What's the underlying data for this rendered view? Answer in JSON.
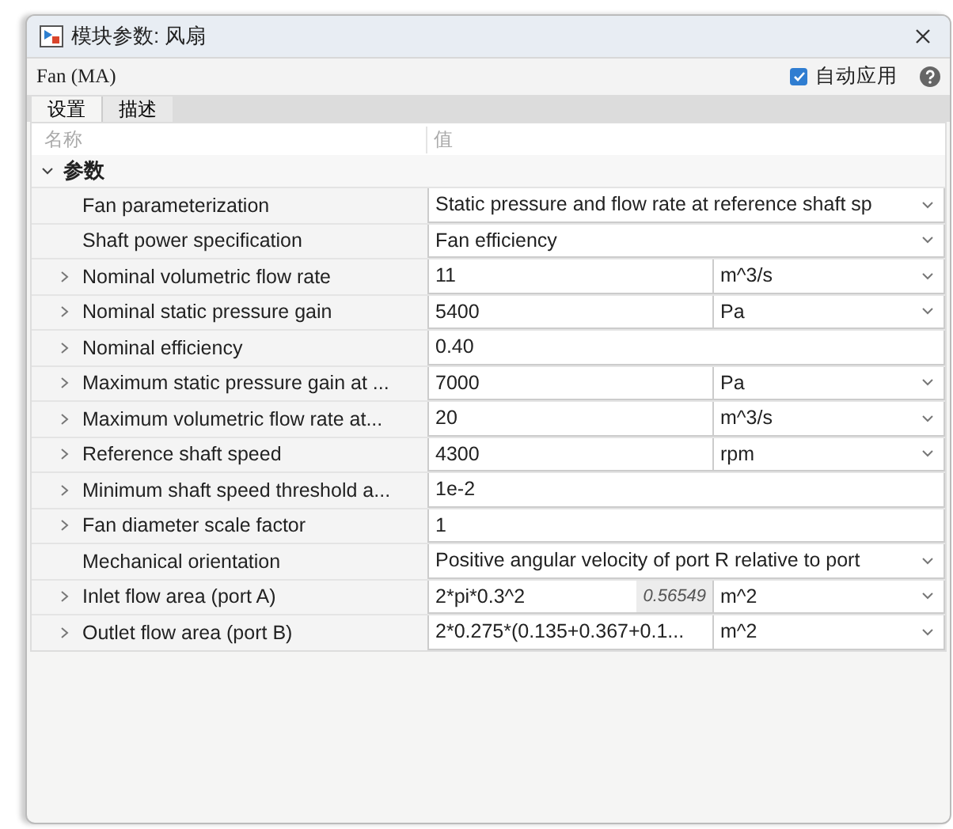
{
  "window": {
    "title": "模块参数: 风扇"
  },
  "block": {
    "name": "Fan (MA)",
    "auto_apply": {
      "label": "自动应用",
      "checked": true
    }
  },
  "tabs": [
    {
      "label": "设置",
      "selected": true
    },
    {
      "label": "描述",
      "selected": false
    }
  ],
  "table": {
    "columns": [
      "名称",
      "值"
    ],
    "section": {
      "label": "参数",
      "expanded": true
    },
    "rows": [
      {
        "kind": "dropdown",
        "expandable": false,
        "name": "Fan parameterization",
        "value": "Static pressure and flow rate at reference shaft sp"
      },
      {
        "kind": "dropdown",
        "expandable": false,
        "name": "Shaft power specification",
        "value": "Fan efficiency"
      },
      {
        "kind": "unit",
        "expandable": true,
        "name": "Nominal volumetric flow rate",
        "value": "11",
        "unit": "m^3/s"
      },
      {
        "kind": "unit",
        "expandable": true,
        "name": "Nominal static pressure gain",
        "value": "5400",
        "unit": "Pa"
      },
      {
        "kind": "plain",
        "expandable": true,
        "name": "Nominal efficiency",
        "value": "0.40"
      },
      {
        "kind": "unit",
        "expandable": true,
        "name": "Maximum static pressure gain at ...",
        "value": "7000",
        "unit": "Pa"
      },
      {
        "kind": "unit",
        "expandable": true,
        "name": "Maximum volumetric flow rate at...",
        "value": "20",
        "unit": "m^3/s"
      },
      {
        "kind": "unit",
        "expandable": true,
        "name": "Reference shaft speed",
        "value": "4300",
        "unit": "rpm"
      },
      {
        "kind": "plain",
        "expandable": true,
        "name": "Minimum shaft speed threshold a...",
        "value": "1e-2"
      },
      {
        "kind": "plain",
        "expandable": true,
        "name": "Fan diameter scale factor",
        "value": "1"
      },
      {
        "kind": "dropdown",
        "expandable": false,
        "name": "Mechanical orientation",
        "value": "Positive angular velocity of port R relative to port"
      },
      {
        "kind": "unit",
        "expandable": true,
        "name": "Inlet flow area (port A)",
        "value": "2*pi*0.3^2",
        "evaluated": "0.56549",
        "unit": "m^2"
      },
      {
        "kind": "unit",
        "expandable": true,
        "name": "Outlet flow area (port B)",
        "value": "2*0.275*(0.135+0.367+0.1...",
        "unit": "m^2"
      }
    ]
  }
}
